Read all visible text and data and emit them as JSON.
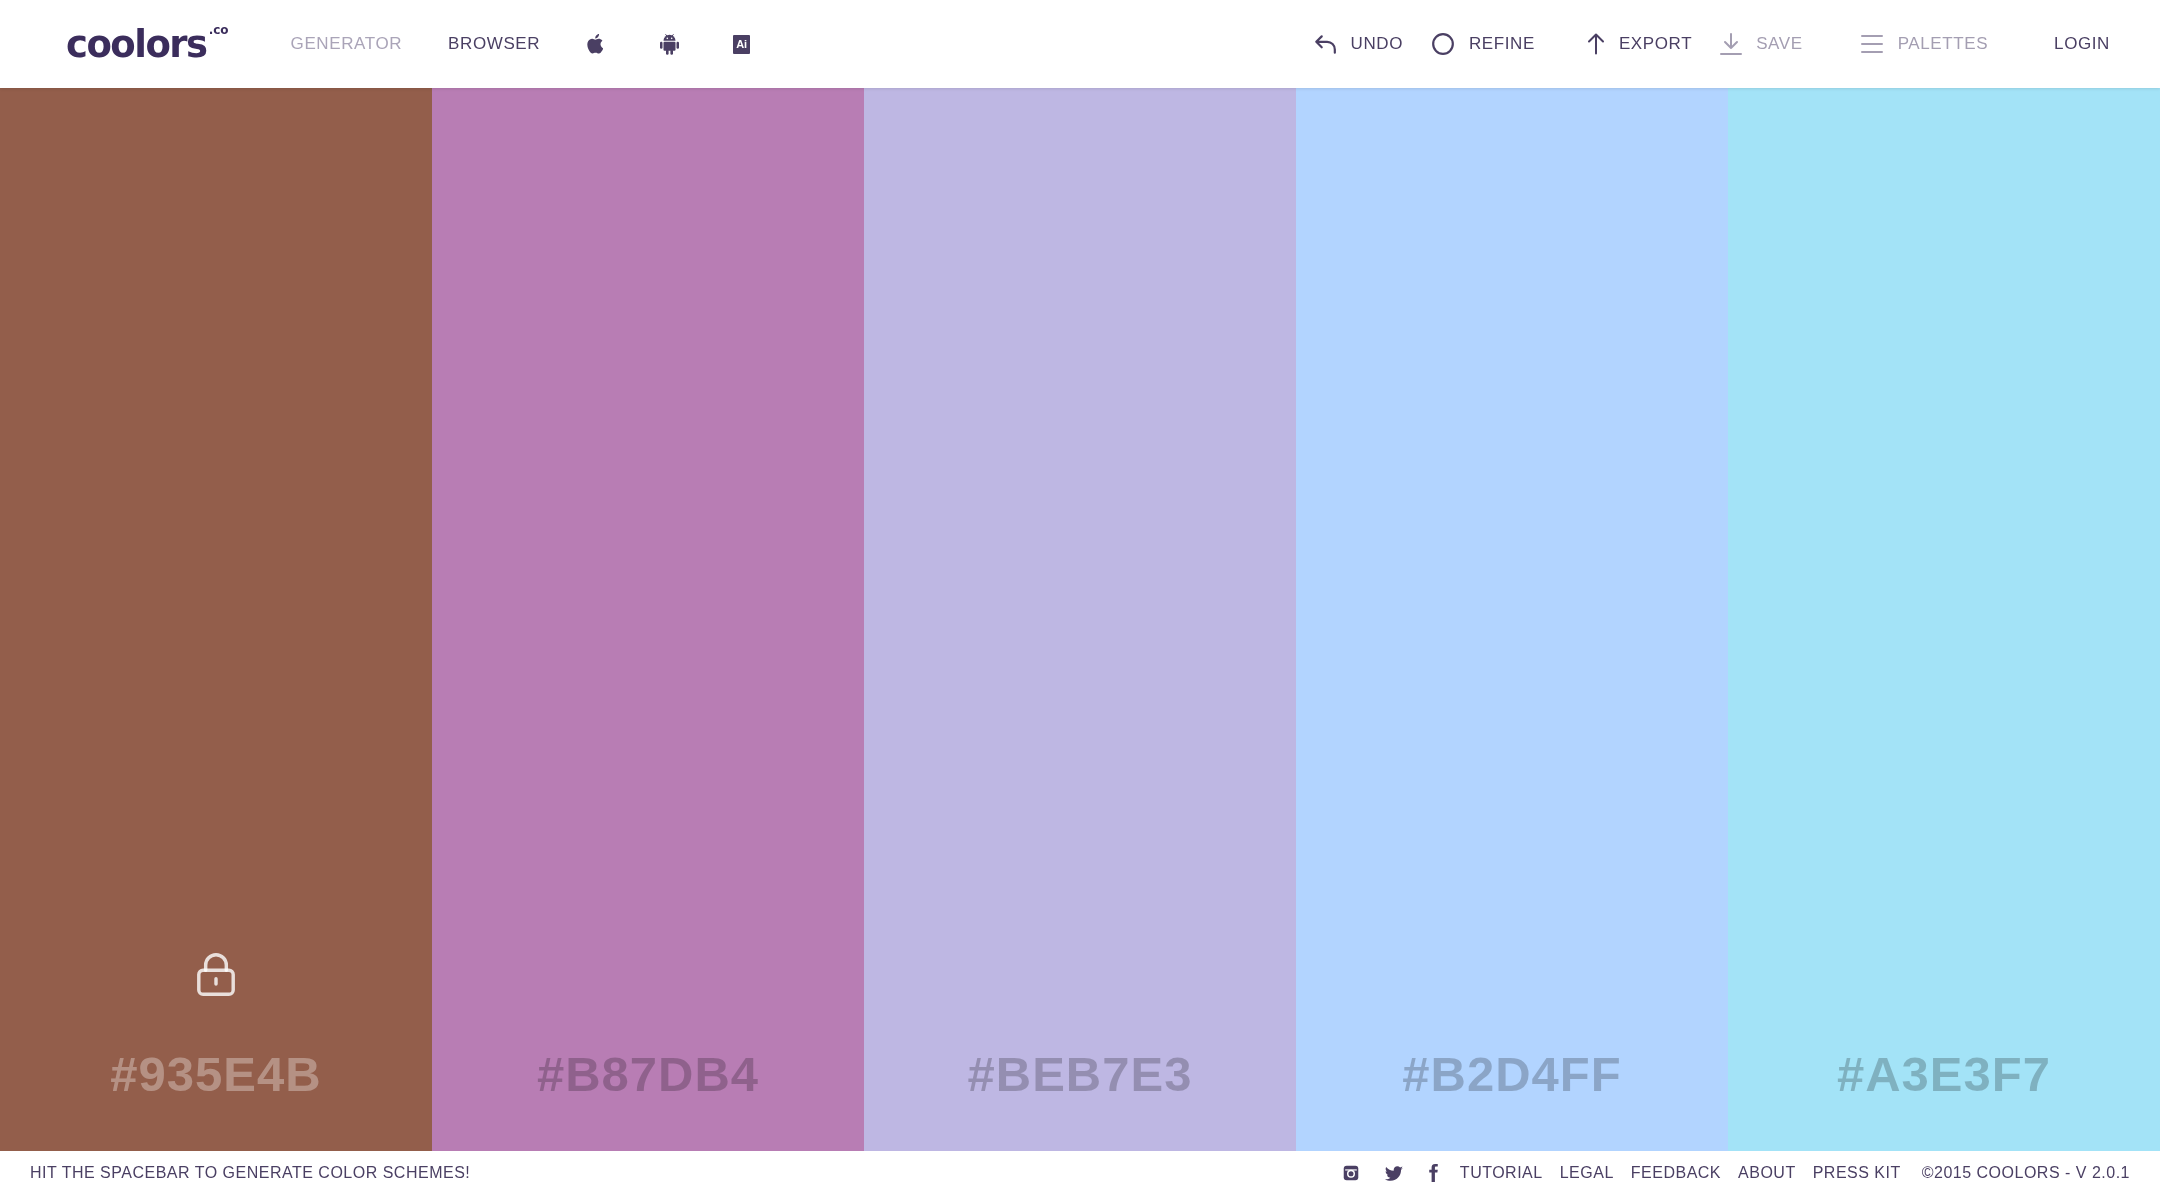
{
  "logo": "coolors$^{.co}$",
  "nav_links": [
    {
      "label": "GENERATOR",
      "selected": true
    },
    {
      "label": "BROWSER",
      "selected": false
    }
  ],
  "app_badge": "Ai",
  "toolbar": [
    {
      "label": "UNDO",
      "disabled": false
    },
    {
      "label": "REFINE",
      "disabled": false
    },
    {
      "label": "EXPORT",
      "disabled": false
    },
    {
      "label": "SAVE",
      "disabled": true
    },
    {
      "label": "PALETTES",
      "disabled": true
    }
  ],
  "login": "LOGIN",
  "swatches": [
    {
      "hex": "#935E4B",
      "color": "#935e4b",
      "hovered": true
    },
    {
      "hex": "#B87DB4",
      "color": "#b87db4",
      "hovered": false
    },
    {
      "hex": "#BEB7E3",
      "color": "#beb7e3",
      "hovered": false
    },
    {
      "hex": "#B2D4FF",
      "color": "#b2d4ff",
      "hovered": false
    },
    {
      "hex": "#A3E3F7",
      "color": "#a3e3f7",
      "hovered": false
    }
  ],
  "status_bar": {
    "hint": "HIT THE SPACEBAR TO GENERATE COLOR SCHEMES!",
    "links": [
      "TUTORIAL",
      "LEGAL",
      "FEEDBACK",
      "ABOUT",
      "PRESS KIT"
    ],
    "copyright": "©2015 COOLORS - V 2.0.1"
  }
}
